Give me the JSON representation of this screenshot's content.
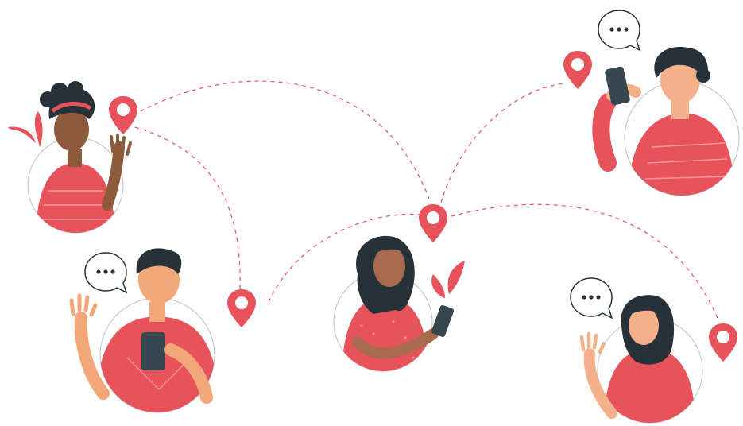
{
  "colors": {
    "accent": "#e8525b",
    "accent_light": "#f07e84",
    "hair": "#263238",
    "phone": "#37474f",
    "skin_dark": "#8d5a3b",
    "skin_brown": "#a86b4f",
    "skin_light": "#f2a67a",
    "skin_peach": "#f4b08a",
    "outline": "#263238",
    "circle_fill": "#ffffff",
    "circle_stroke": "#c9c9c9",
    "dashed_path": "#e8525b"
  },
  "people": [
    {
      "id": "woman-top-left",
      "gesture": "waving"
    },
    {
      "id": "man-bottom-left",
      "gesture": "waving-with-phone",
      "speech_bubble": true
    },
    {
      "id": "woman-center",
      "gesture": "using-phone"
    },
    {
      "id": "man-top-right",
      "gesture": "phone-call",
      "speech_bubble": true
    },
    {
      "id": "woman-bottom-right",
      "gesture": "waving",
      "speech_bubble": true
    }
  ],
  "icons": {
    "pin": "location-pin-icon",
    "bubble": "speech-bubble-icon",
    "phone": "smartphone-icon",
    "leaf": "leaf-icon"
  }
}
